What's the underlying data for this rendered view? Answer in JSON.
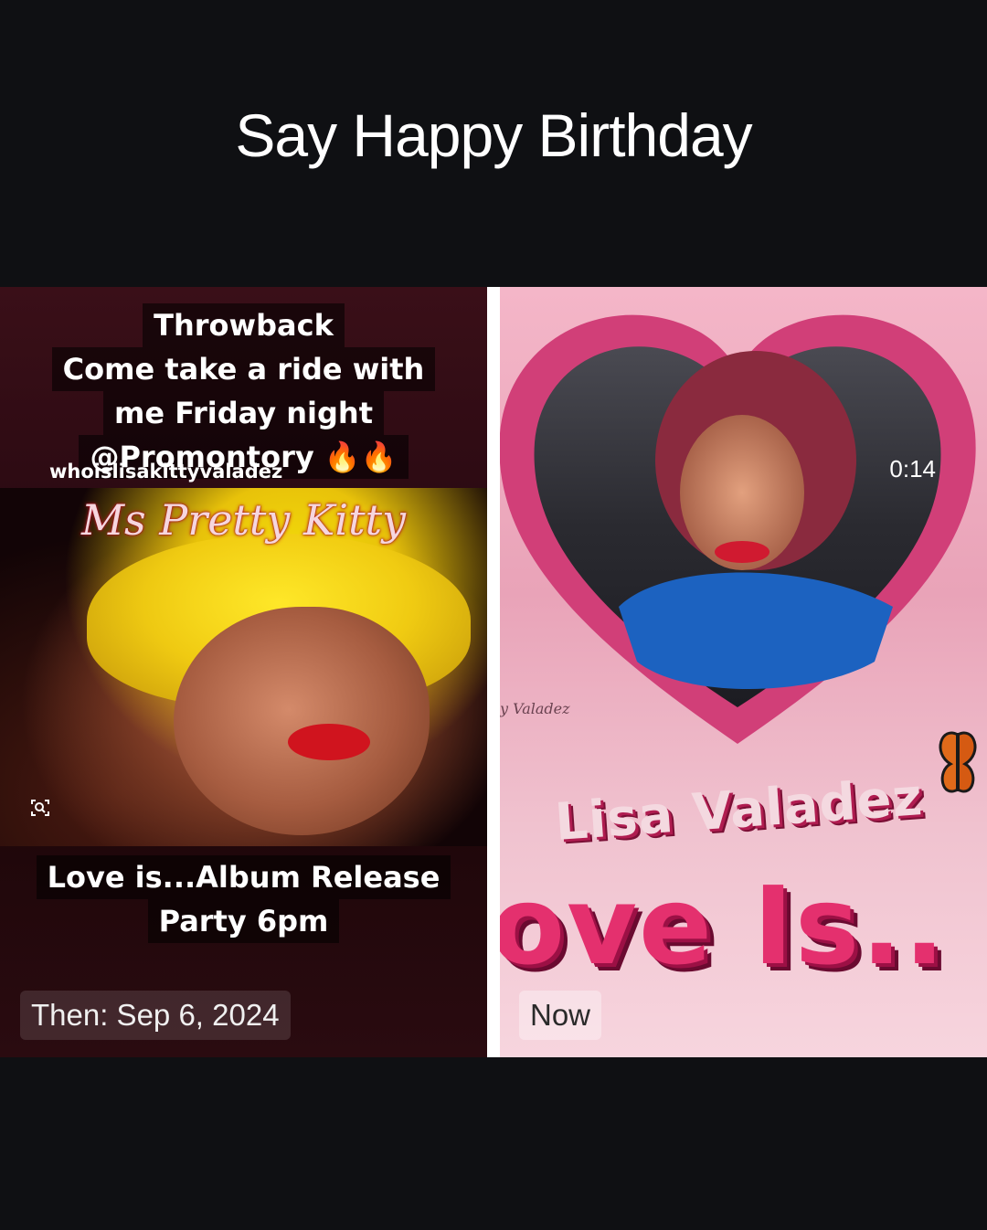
{
  "headline": "Say Happy Birthday",
  "left_panel": {
    "flyer_lines": [
      "Throwback",
      "Come take a ride with",
      "me Friday night",
      "@Promontory 🔥🔥"
    ],
    "watermark": "whoislisakittyvaladez",
    "script_title": "Ms Pretty Kitty",
    "bottom_lines": [
      "Love is...Album Release",
      "Party 6pm"
    ],
    "caption": "Then: Sep 6, 2024"
  },
  "right_panel": {
    "timer": "0:14",
    "artist_name": "Lisa Valadez",
    "album_title": "ove Is..",
    "caption": "Now"
  },
  "colors": {
    "background": "#0f1013",
    "heart_pink": "#d13f78",
    "album_pink": "#e4306e"
  },
  "icons": {
    "lens": "visual-search-icon",
    "butterfly": "butterfly-icon"
  }
}
